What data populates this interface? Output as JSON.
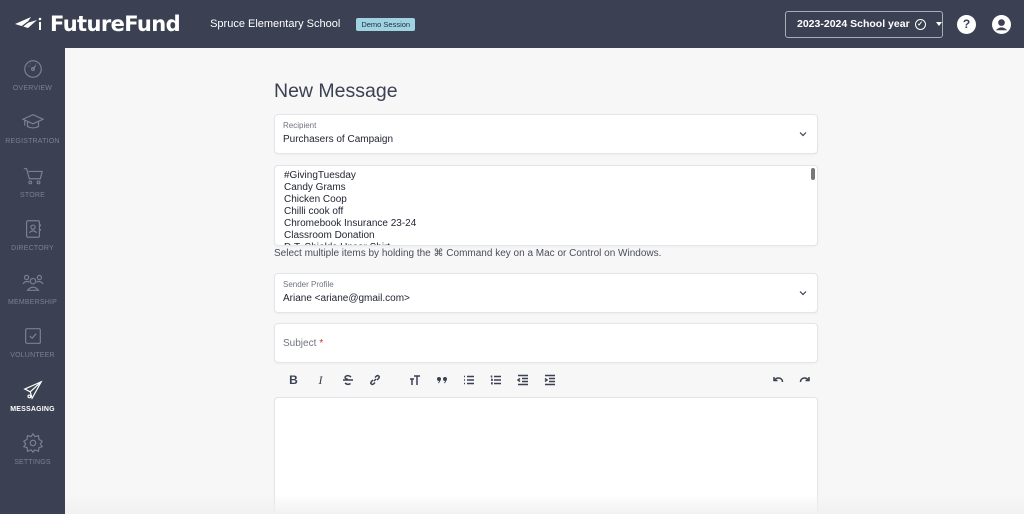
{
  "header": {
    "brand": "FutureFund",
    "school_name": "Spruce Elementary School",
    "session_badge": "Demo Session",
    "school_year": "2023-2024 School year",
    "help_icon": "question-circle-icon",
    "account_icon": "user-circle-icon"
  },
  "sidebar": {
    "items": [
      {
        "label": "OVERVIEW",
        "icon": "gauge-icon",
        "active": false
      },
      {
        "label": "REGISTRATION",
        "icon": "graduation-cap-icon",
        "active": false
      },
      {
        "label": "STORE",
        "icon": "cart-icon",
        "active": false
      },
      {
        "label": "DIRECTORY",
        "icon": "contact-book-icon",
        "active": false
      },
      {
        "label": "MEMBERSHIP",
        "icon": "people-icon",
        "active": false
      },
      {
        "label": "VOLUNTEER",
        "icon": "checkbox-icon",
        "active": false
      },
      {
        "label": "MESSAGING",
        "icon": "paper-plane-icon",
        "active": true
      },
      {
        "label": "SETTINGS",
        "icon": "gear-icon",
        "active": false
      }
    ]
  },
  "form": {
    "title": "New Message",
    "recipient": {
      "label": "Recipient",
      "value": "Purchasers of Campaign"
    },
    "campaigns": [
      "#GivingTuesday",
      "Candy Grams",
      "Chicken Coop",
      "Chilli cook off",
      "Chromebook Insurance 23-24",
      "Classroom Donation",
      "D.T. Shields Unser Shirt"
    ],
    "multi_select_hint": "Select multiple items by holding the ⌘ Command key on a Mac or Control on Windows.",
    "sender": {
      "label": "Sender Profile",
      "value": "Ariane <ariane@gmail.com>"
    },
    "subject": {
      "placeholder": "Subject",
      "required_mark": "*",
      "value": ""
    },
    "toolbar": {
      "bold": "B",
      "italic": "I",
      "strike": "strikethrough-icon",
      "link": "link-icon",
      "heading": "text-size-icon",
      "quote": "quote-icon",
      "bullet_list": "bullet-list-icon",
      "numbered_list": "numbered-list-icon",
      "outdent": "outdent-icon",
      "indent": "indent-icon",
      "undo": "undo-icon",
      "redo": "redo-icon"
    },
    "body": ""
  }
}
